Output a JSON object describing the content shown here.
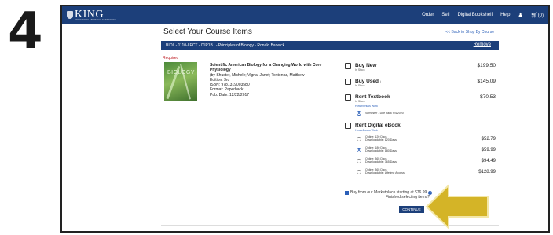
{
  "step_number": "4",
  "header": {
    "logo_text": "KING",
    "logo_subtext": "UNIVERSITY · BRISTOL, TENNESSEE",
    "nav": [
      "Order",
      "Sell",
      "Digital Bookshelf",
      "Help"
    ],
    "cart_count": "(0)"
  },
  "page": {
    "title": "Select Your Course Items",
    "back_link": "<< Back to Shop By Course"
  },
  "course": {
    "code": "BIOL - 1110-LECT - 01P1B",
    "title": "- Principles of Biology - Ronald Barwick",
    "remove_label": "Remove"
  },
  "required_label": "Required",
  "book": {
    "cover_text": "BIOLOGY",
    "title_line1": "Scientific American Biology for a Changing World with Core",
    "title_line2": "Physiology",
    "authors": "(by Shuster, Michele; Vigna, Janet; Tontonoz, Matthew",
    "edition": "Edition: 3rd",
    "isbn": "ISBN: 9781319003580",
    "format": "Format: Paperback",
    "pub_date": "Pub. Date: 12/22/2017"
  },
  "options": {
    "buy_new": {
      "label": "Buy New",
      "stock": "In Stock",
      "price": "$199.50"
    },
    "buy_used": {
      "label": "Buy Used",
      "info": "i",
      "stock": "In Stock",
      "price": "$145.09"
    },
    "rent_textbook": {
      "label": "Rent Textbook",
      "stock": "In Stock",
      "how_link": "How Rentals Work",
      "price": "$70.53",
      "term": "Semester - Due back 9/4/2020"
    },
    "rent_ebook": {
      "label": "Rent Digital eBook",
      "how_link": "How eBooks Work",
      "choices": [
        {
          "line1": "Online: 120 Days",
          "line2": "Downloadable: 120 Days",
          "price": "$52.79",
          "selected": false
        },
        {
          "line1": "Online: 180 Days",
          "line2": "Downloadable: 180 Days",
          "price": "$59.99",
          "selected": true
        },
        {
          "line1": "Online: 365 Days",
          "line2": "Downloadable: 365 Days",
          "price": "$94.49",
          "selected": false
        },
        {
          "line1": "Online: 365 Days",
          "line2": "Downloadable: Lifetime Access",
          "price": "$128.99",
          "selected": false
        }
      ]
    },
    "marketplace": "Buy from our Marketplace starting at $76.99"
  },
  "footer": {
    "finished_text": "Finished selecting items?",
    "continue_label": "CONTINUE"
  },
  "colors": {
    "brand_navy": "#1c3f7a",
    "link_blue": "#2b5fb8",
    "required_red": "#c0262c",
    "arrow_yellow": "#d4b427"
  }
}
